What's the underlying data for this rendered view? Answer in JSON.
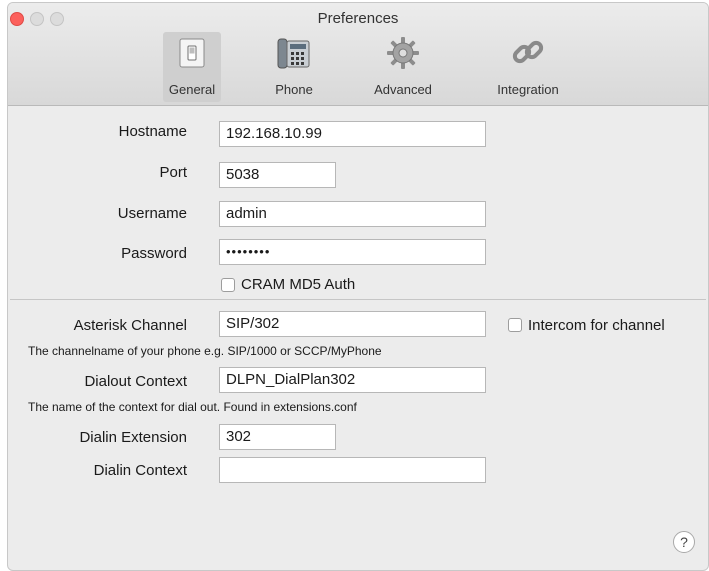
{
  "window": {
    "title": "Preferences"
  },
  "toolbar": {
    "tabs": [
      {
        "label": "General",
        "icon": "switch-icon",
        "selected": true
      },
      {
        "label": "Phone",
        "icon": "phone-icon",
        "selected": false
      },
      {
        "label": "Advanced",
        "icon": "gear-icon",
        "selected": false
      },
      {
        "label": "Integration",
        "icon": "chain-link-icon",
        "selected": false
      }
    ]
  },
  "server": {
    "hostname_label": "Hostname",
    "hostname_value": "192.168.10.99",
    "port_label": "Port",
    "port_value": "5038",
    "username_label": "Username",
    "username_value": "admin",
    "password_label": "Password",
    "password_value": "••••••••",
    "cram_label": "CRAM MD5 Auth",
    "cram_checked": false
  },
  "channel": {
    "asterisk_channel_label": "Asterisk Channel",
    "asterisk_channel_value": "SIP/302",
    "intercom_label": "Intercom for channel",
    "intercom_checked": false,
    "channel_hint": "The channelname of your phone e.g. SIP/1000 or SCCP/MyPhone",
    "dialout_context_label": "Dialout Context",
    "dialout_context_value": "DLPN_DialPlan302",
    "dialout_hint": "The name of the context for dial out. Found in extensions.conf",
    "dialin_extension_label": "Dialin Extension",
    "dialin_extension_value": "302",
    "dialin_context_label": "Dialin Context",
    "dialin_context_value": ""
  },
  "help": {
    "glyph": "?"
  },
  "colors": {
    "close": "#fc605c",
    "selected_tab": "#cfcfcf"
  }
}
